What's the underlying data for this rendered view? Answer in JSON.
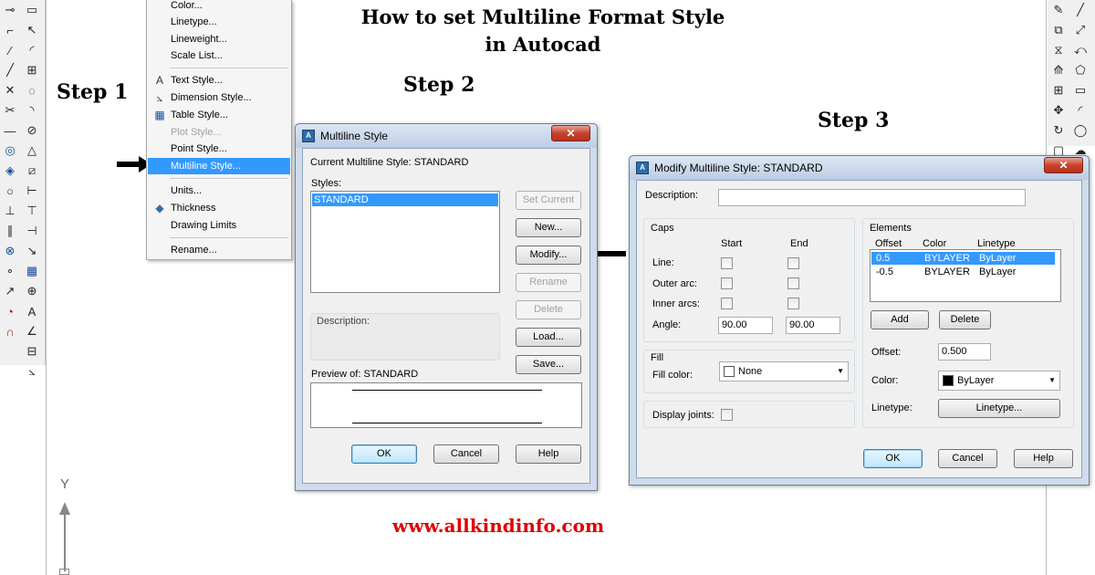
{
  "page": {
    "title_line1": "How to set Multiline Format Style",
    "title_line2": "in Autocad",
    "step1": "Step 1",
    "step2": "Step 2",
    "step3": "Step 3",
    "website": "www.allkindinfo.com"
  },
  "canvas": {
    "ucs_y": "Y"
  },
  "format_menu": {
    "items": [
      {
        "label": "Color...",
        "disabled": false
      },
      {
        "label": "Linetype...",
        "disabled": false
      },
      {
        "label": "Lineweight...",
        "disabled": false
      },
      {
        "label": "Scale List...",
        "disabled": false
      },
      {
        "label": "Text Style...",
        "disabled": false,
        "icon": "text-style-icon"
      },
      {
        "label": "Dimension Style...",
        "disabled": false,
        "icon": "dimension-style-icon"
      },
      {
        "label": "Table Style...",
        "disabled": false,
        "icon": "table-style-icon"
      },
      {
        "label": "Plot Style...",
        "disabled": true
      },
      {
        "label": "Point Style...",
        "disabled": false
      },
      {
        "label": "Multiline Style...",
        "disabled": false,
        "selected": true
      },
      {
        "label": "Units...",
        "disabled": false
      },
      {
        "label": "Thickness",
        "disabled": false,
        "icon": "thickness-icon"
      },
      {
        "label": "Drawing Limits",
        "disabled": false
      },
      {
        "label": "Rename...",
        "disabled": false
      }
    ]
  },
  "multiline_style_dialog": {
    "title": "Multiline Style",
    "close": "✕",
    "current_style": "Current Multiline Style: STANDARD",
    "styles_label": "Styles:",
    "styles": [
      "STANDARD"
    ],
    "description_label": "Description:",
    "preview_label": "Preview of: STANDARD",
    "buttons": {
      "set_current": "Set Current",
      "new": "New...",
      "modify": "Modify...",
      "rename": "Rename",
      "delete": "Delete",
      "load": "Load...",
      "save": "Save...",
      "ok": "OK",
      "cancel": "Cancel",
      "help": "Help"
    }
  },
  "modify_dialog": {
    "title": "Modify Multiline Style: STANDARD",
    "close": "✕",
    "description_label": "Description:",
    "description_value": "",
    "caps": {
      "label": "Caps",
      "start": "Start",
      "end": "End",
      "line": "Line:",
      "outer_arc": "Outer arc:",
      "inner_arcs": "Inner arcs:",
      "angle": "Angle:",
      "angle_start": "90.00",
      "angle_end": "90.00"
    },
    "fill": {
      "label": "Fill",
      "fill_color_label": "Fill color:",
      "fill_color_value": "None"
    },
    "display_joints": "Display joints:",
    "elements": {
      "label": "Elements",
      "headers": [
        "Offset",
        "Color",
        "Linetype"
      ],
      "rows": [
        {
          "offset": "0.5",
          "color": "BYLAYER",
          "linetype": "ByLayer"
        },
        {
          "offset": "-0.5",
          "color": "BYLAYER",
          "linetype": "ByLayer"
        }
      ],
      "add": "Add",
      "delete": "Delete",
      "offset_label": "Offset:",
      "offset_value": "0.500",
      "color_label": "Color:",
      "color_value": "ByLayer",
      "linetype_label": "Linetype:",
      "linetype_button": "Linetype..."
    },
    "buttons": {
      "ok": "OK",
      "cancel": "Cancel",
      "help": "Help"
    }
  },
  "colors": {
    "highlight": "#3399ff",
    "website": "#e00000",
    "close_button": "#c7432d"
  }
}
